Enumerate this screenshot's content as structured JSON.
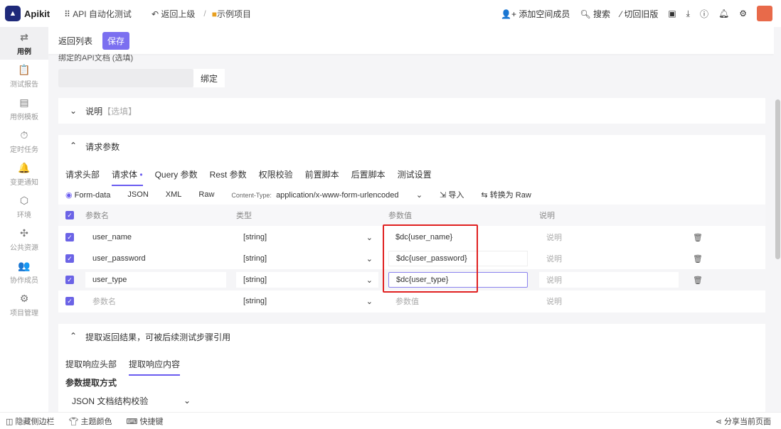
{
  "top": {
    "brand": "Apikit",
    "workspace": "API 自动化测试",
    "back": "返回上级",
    "sep": "/",
    "project": "示例项目",
    "add_member": "添加空间成员",
    "search": "搜索",
    "old_version": "切回旧版"
  },
  "sidebar": [
    {
      "label": "用例",
      "icon": "⇄"
    },
    {
      "label": "测试报告",
      "icon": "📋"
    },
    {
      "label": "用例模板",
      "icon": "▤"
    },
    {
      "label": "定时任务",
      "icon": "⏱"
    },
    {
      "label": "变更通知",
      "icon": "🔔"
    },
    {
      "label": "环境",
      "icon": "⬡"
    },
    {
      "label": "公共资源",
      "icon": "✣"
    },
    {
      "label": "协作成员",
      "icon": "👥"
    },
    {
      "label": "项目管理",
      "icon": "⚙"
    }
  ],
  "header": {
    "back_list": "返回列表",
    "save": "保存"
  },
  "bind": {
    "label": "绑定的API文档 (选填)",
    "button": "绑定"
  },
  "desc": {
    "label": "说明",
    "hint": "【选填】"
  },
  "params": {
    "title": "请求参数",
    "tabs": [
      "请求头部",
      "请求体",
      "Query 参数",
      "Rest 参数",
      "权限校验",
      "前置脚本",
      "后置脚本",
      "测试设置"
    ],
    "body_types": [
      "Form-data",
      "JSON",
      "XML",
      "Raw"
    ],
    "content_type_label": "Content-Type:",
    "content_type": "application/x-www-form-urlencoded",
    "import": "导入",
    "to_raw": "转换为 Raw",
    "columns": [
      "参数名",
      "类型",
      "参数值",
      "说明"
    ],
    "rows": [
      {
        "name": "user_name",
        "type": "[string]",
        "value": "$dc{user_name}",
        "desc": "说明"
      },
      {
        "name": "user_password",
        "type": "[string]",
        "value": "$dc{user_password}",
        "desc": "说明"
      },
      {
        "name": "user_type",
        "type": "[string]",
        "value": "$dc{user_type}",
        "desc": "说明"
      }
    ],
    "new_row": {
      "name": "参数名",
      "type": "[string]",
      "value": "参数值",
      "desc": "说明"
    }
  },
  "extract": {
    "title": "提取返回结果，可被后续测试步骤引用",
    "tabs": [
      "提取响应头部",
      "提取响应内容"
    ],
    "method_label": "参数提取方式",
    "method": "JSON 文档结构校验"
  },
  "bottom": {
    "hide_sidebar": "隐藏侧边栏",
    "theme": "主题颜色",
    "shortcuts": "快捷键",
    "share": "分享当前页面"
  }
}
